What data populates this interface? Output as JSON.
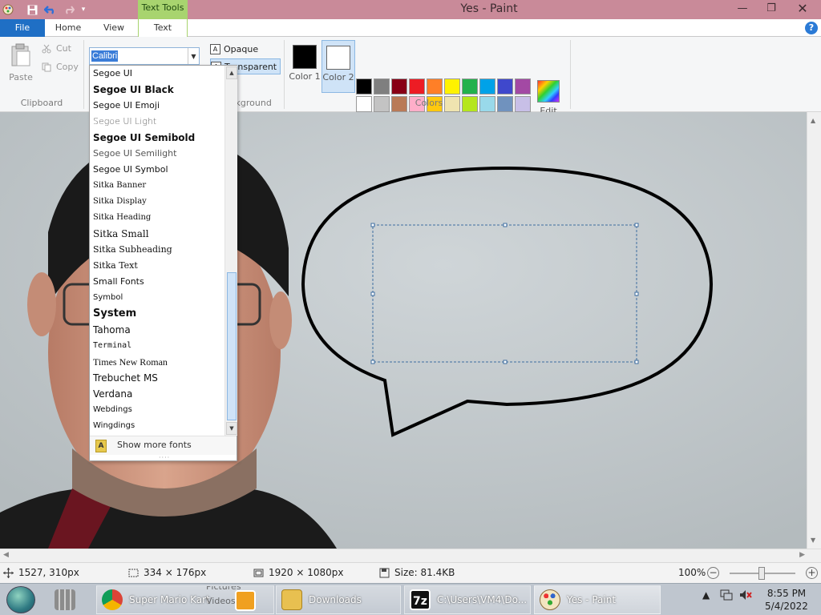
{
  "window": {
    "title": "Yes - Paint",
    "context_tab": "Text Tools",
    "minimize": "—",
    "restore": "❐",
    "close": "✕"
  },
  "tabs": {
    "file": "File",
    "home": "Home",
    "view": "View",
    "text": "Text"
  },
  "help": "?",
  "ribbon": {
    "clipboard": {
      "paste": "Paste",
      "cut": "Cut",
      "copy": "Copy",
      "label": "Clipboard"
    },
    "font": {
      "current_font": "Calibri"
    },
    "background": {
      "opaque": "Opaque",
      "transparent": "Transparent",
      "label": "Background"
    },
    "colors": {
      "color1": {
        "label": "Color 1",
        "value": "#000000"
      },
      "color2": {
        "label": "Color 2",
        "value": "#ffffff"
      },
      "label": "Colors",
      "edit": "Edit colors",
      "palette": [
        "#000000",
        "#7f7f7f",
        "#880015",
        "#ed1c24",
        "#ff7f27",
        "#fff200",
        "#22b14c",
        "#00a2e8",
        "#3f48cc",
        "#a349a4",
        "#ffffff",
        "#c3c3c3",
        "#b97a57",
        "#ffaec9",
        "#ffc90e",
        "#efe4b0",
        "#b5e61d",
        "#99d9ea",
        "#7092be",
        "#c8bfe7",
        "",
        "",
        "",
        "",
        "",
        "",
        "",
        "",
        "",
        ""
      ]
    }
  },
  "font_dropdown": {
    "fonts": [
      "Segoe UI",
      "Segoe UI Black",
      "Segoe UI Emoji",
      "Segoe UI Light",
      "Segoe UI Semibold",
      "Segoe UI Semilight",
      "Segoe UI Symbol",
      "Sitka Banner",
      "Sitka Display",
      "Sitka Heading",
      "Sitka Small",
      "Sitka Subheading",
      "Sitka Text",
      "Small Fonts",
      "Symbol",
      "System",
      "Tahoma",
      "Terminal",
      "Times New Roman",
      "Trebuchet MS",
      "Verdana",
      "Webdings",
      "Wingdings"
    ],
    "show_more": "Show more fonts"
  },
  "status": {
    "cursor": "1527, 310px",
    "selection": "334 × 176px",
    "image_size": "1920 × 1080px",
    "file_size": "Size: 81.4KB",
    "zoom": "100%"
  },
  "taskbar": {
    "chrome": "Super Mario Kart",
    "downloads": "Downloads",
    "sevenzip": "C:\\Users\\VM4\\Do...",
    "paint": "Yes - Paint",
    "ghost_pictures": "Pictures",
    "ghost_videos": "Videos",
    "time": "8:55 PM",
    "date": "5/4/2022"
  }
}
